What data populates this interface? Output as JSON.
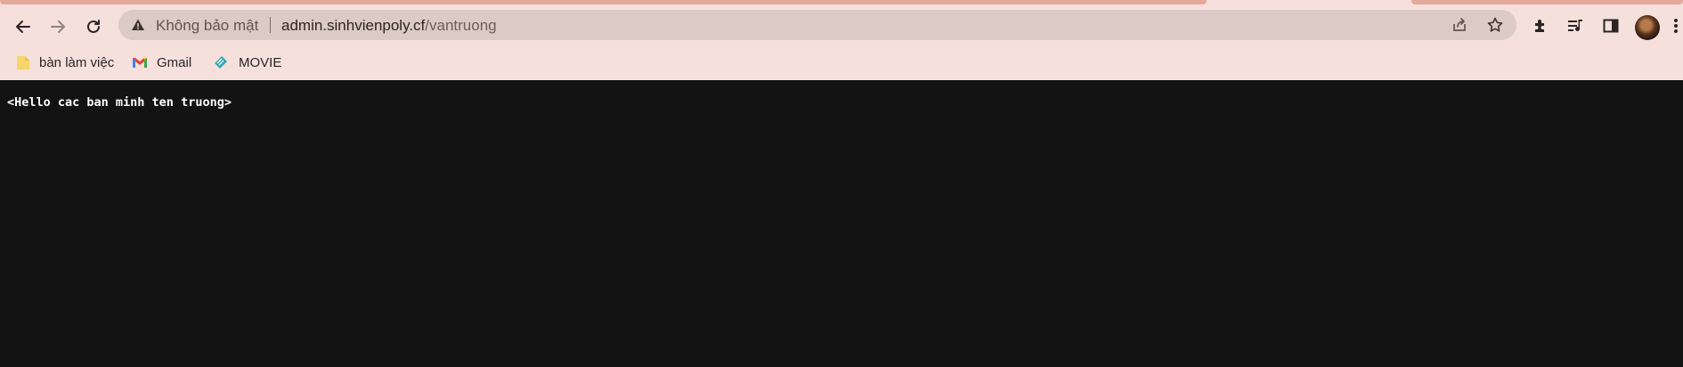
{
  "browser": {
    "security_label": "Không bảo mật",
    "url_host": "admin.sinhvienpoly.cf",
    "url_path": "/vantruong",
    "nav": {
      "back_icon": "back-arrow-icon",
      "forward_icon": "forward-arrow-icon",
      "reload_icon": "reload-icon"
    },
    "omnibox_icons": [
      "warning-icon",
      "share-icon",
      "star-icon"
    ],
    "toolbar_icons": [
      "extensions-icon",
      "media-queue-icon",
      "side-panel-icon",
      "profile-avatar",
      "menu-dots-icon"
    ],
    "colors": {
      "frame": "#f5e0db",
      "omnibox": "#dccac4",
      "accent": "#e6a89b"
    }
  },
  "bookmarks": [
    {
      "label": "bàn làm việc",
      "icon": "folder-icon"
    },
    {
      "label": "Gmail",
      "icon": "gmail-icon"
    },
    {
      "label": "MOVIE",
      "icon": "ticket-icon"
    }
  ],
  "page": {
    "text": "<Hello cac ban minh ten truong>",
    "background": "#131313"
  }
}
